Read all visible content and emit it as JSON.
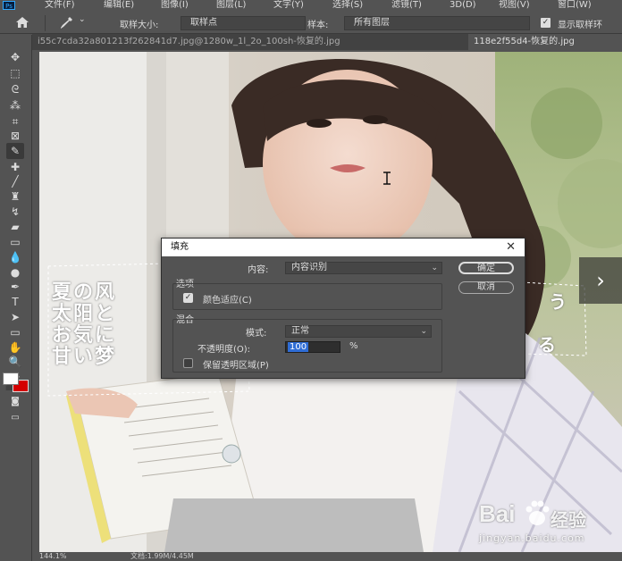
{
  "menubar": {
    "app_icon": "Ps",
    "items": [
      "文件(F)",
      "编辑(E)",
      "图像(I)",
      "图层(L)",
      "文字(Y)",
      "选择(S)",
      "滤镜(T)",
      "3D(D)",
      "视图(V)",
      "窗口(W)"
    ]
  },
  "optionsbar": {
    "sample_size_label": "取样大小:",
    "sample_size_value": "取样点",
    "sample_label": "样本:",
    "sample_value": "所有图层",
    "show_ring_label": "显示取样环"
  },
  "tabs": [
    {
      "label": "i55c7cda32a801213f262841d7.jpg@1280w_1l_2o_100sh-恢复的.jpg",
      "active": false
    },
    {
      "label": "118e2f55d4-恢复的.jpg",
      "active": true
    }
  ],
  "status": {
    "zoom": "144.1%",
    "doc": "文档:1.99M/4.45M"
  },
  "dialog": {
    "title": "填充",
    "content_label": "内容:",
    "content_value": "内容识别",
    "ok_label": "确定",
    "cancel_label": "取消",
    "options_title": "选项",
    "color_adapt_label": "颜色适应(C)",
    "color_adapt_checked": true,
    "blend_title": "混合",
    "mode_label": "模式:",
    "mode_value": "正常",
    "opacity_label": "不透明度(O):",
    "opacity_value": "100",
    "opacity_unit": "%",
    "preserve_label": "保留透明区域(P)",
    "preserve_checked": false
  },
  "canvas": {
    "jp_lines": [
      "夏の风",
      "太阳と",
      "お気に",
      "甘い梦"
    ],
    "jp_right": [
      "う",
      "る"
    ]
  },
  "watermark": {
    "brand": "Bai",
    "brand_suffix": "经验",
    "url": "jingyan.baidu.com"
  },
  "colors": {
    "ps_gray": "#535353",
    "dialog_titlebar": "#ffffff",
    "selection_blue": "#2f6dd5",
    "background_swatch": "#d40000"
  }
}
